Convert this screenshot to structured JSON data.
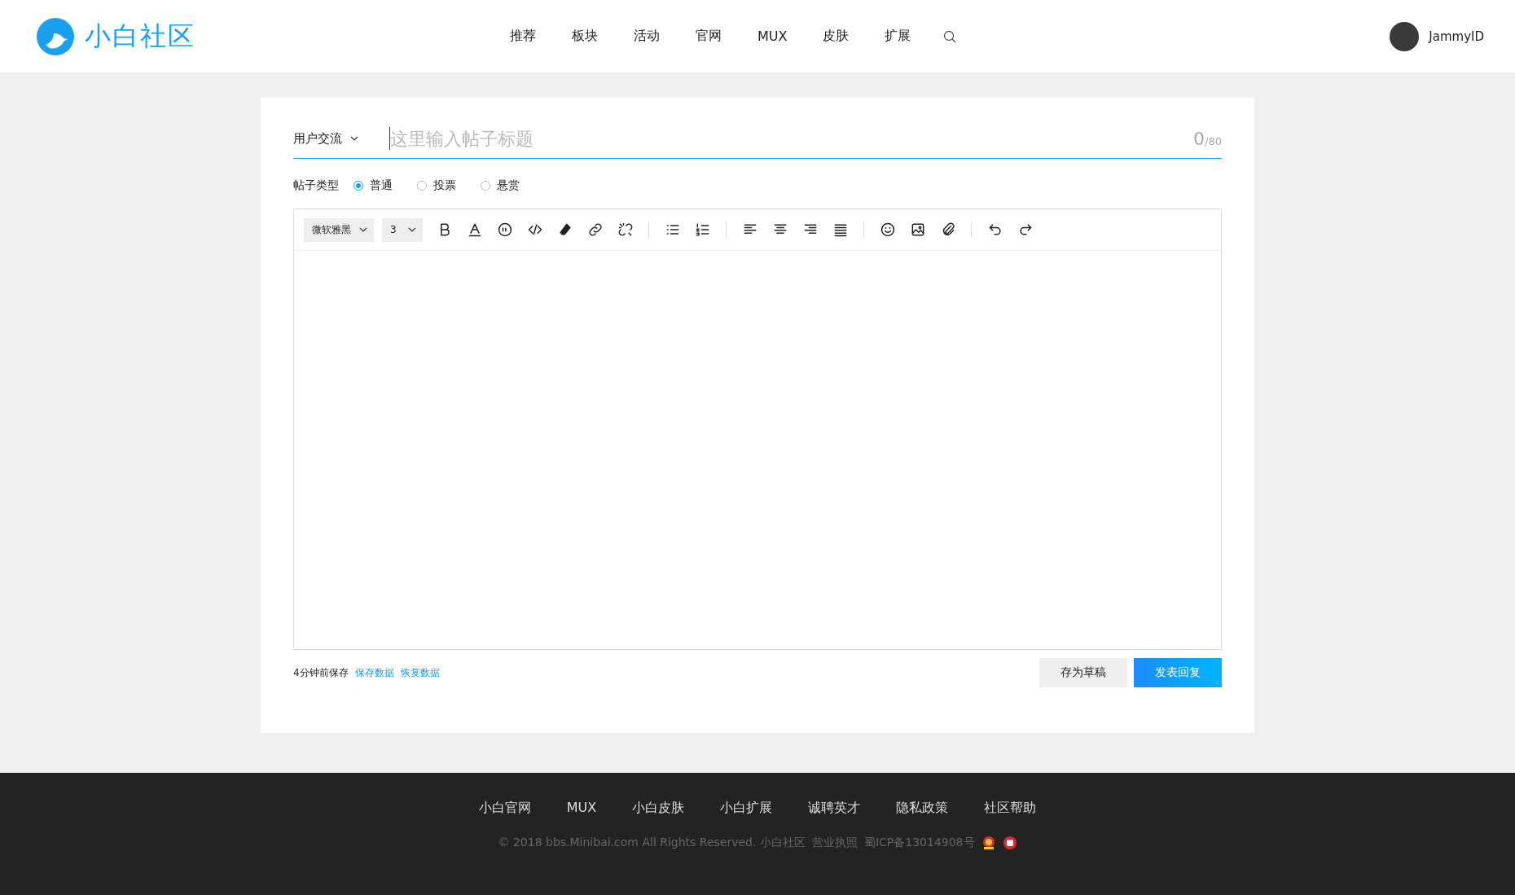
{
  "header": {
    "logo": "小白社区",
    "nav": [
      {
        "label": "推荐",
        "selected": false
      },
      {
        "label": "板块",
        "selected": false
      },
      {
        "label": "活动",
        "selected": false
      },
      {
        "label": "官网",
        "selected": false
      },
      {
        "label": "MUX",
        "selected": false
      },
      {
        "label": "皮肤",
        "selected": false
      },
      {
        "label": "扩展",
        "selected": false
      }
    ],
    "user": "JammyID"
  },
  "form": {
    "category": "用户交流",
    "title": {
      "placeholder": "这里输入帖子标题",
      "count": "0",
      "limit": "/80"
    },
    "post_type": {
      "label": "帖子类型",
      "options": [
        {
          "label": "普通",
          "selected": true
        },
        {
          "label": "投票",
          "selected": false
        },
        {
          "label": "悬赏",
          "selected": false
        }
      ]
    },
    "toolbar": {
      "font": "微软雅黑",
      "size": "3"
    },
    "status": {
      "saved": "4分钟前保存",
      "links": [
        "保存数据",
        "恢复数据"
      ]
    },
    "buttons": [
      {
        "label": "存为草稿",
        "kind": "secondary"
      },
      {
        "label": "发表回复",
        "kind": "primary"
      }
    ]
  },
  "footer": {
    "links": [
      "小白官网",
      "MUX",
      "小白皮肤",
      "小白扩展",
      "诚聘英才",
      "隐私政策",
      "社区帮助"
    ],
    "copyright": "© 2018 bbs.Minibai.com All Rights Reserved. 小白社区",
    "license": "营业执照",
    "icp": "蜀ICP备13014908号"
  }
}
